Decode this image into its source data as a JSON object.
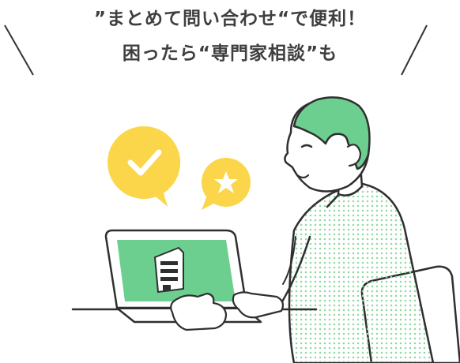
{
  "headline": {
    "line1": "”まとめて問い合わせ“で便利！",
    "line2": "困ったら“専門家相談”も"
  },
  "colors": {
    "text": "#3f3f3f",
    "outline": "#2f2f2f",
    "hair_green": "#6ccf8f",
    "screen_green": "#6ccf8f",
    "bubble_yellow": "#fbd64a",
    "shirt_dots": "#8fd9a0",
    "background": "#ffffff"
  },
  "icons": {
    "bubble_left": "check-icon",
    "bubble_right": "star-icon",
    "screen": "office-building-icon"
  }
}
